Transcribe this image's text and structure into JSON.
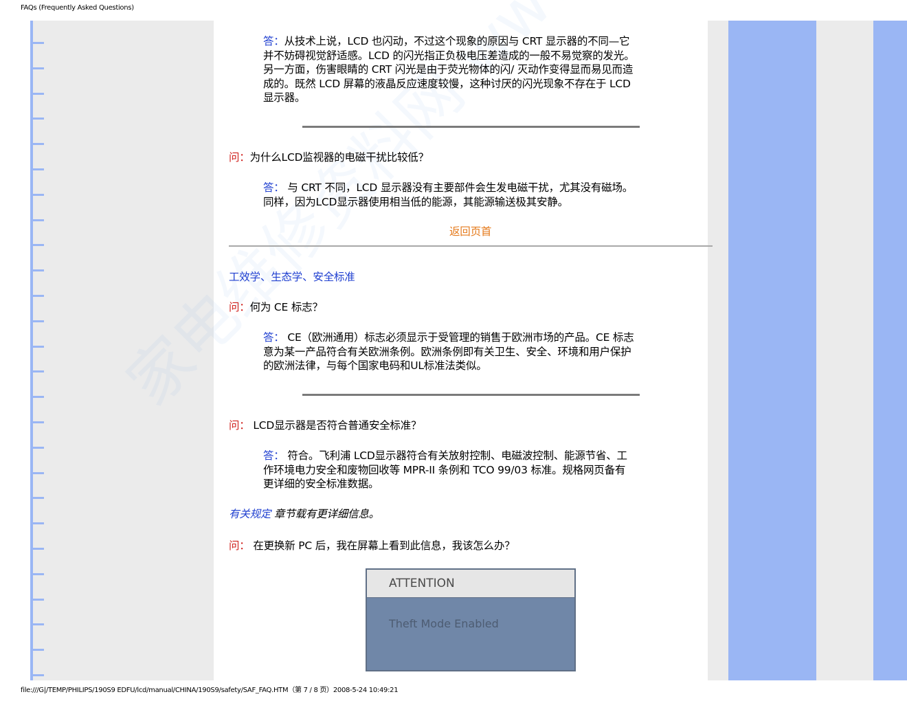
{
  "header": {
    "title": "FAQs (Frequently Asked Questions)"
  },
  "footer": {
    "path": "file:///G|/TEMP/PHILIPS/190S9 EDFU/lcd/manual/CHINA/190S9/safety/SAF_FAQ.HTM（第 7 / 8 页）2008-5-24 10:49:21"
  },
  "labels": {
    "q": "问：",
    "a": "答："
  },
  "qa1": {
    "lines": [
      "从技术上说，LCD 也闪动，不过这个现象的原因与  CRT  显示器的不同—它",
      "并不妨碍视觉舒适感。LCD 的闪光指正负极电压差造成的一般不易觉察的发光。",
      "另一方面，伤害眼睛的  CRT  闪光是由于荧光物体的闪/ 灭动作变得显而易见而造",
      "成的。既然  LCD 屏幕的液晶反应速度较慢，这种讨厌的闪光现象不存在于  LCD",
      "显示器。"
    ]
  },
  "qa2": {
    "question": "为什么LCD监视器的电磁干扰比较低？",
    "lines": [
      " 与  CRT  不同，LCD 显示器没有主要部件会生发电磁干扰，尤其没有磁场。",
      "同样，因为LCD显示器使用相当低的能源，其能源输送极其安静。"
    ]
  },
  "back_to_top": "返回页首",
  "section": {
    "title": "工效学、生态学、安全标准"
  },
  "qa3": {
    "question": "何为  CE  标志？",
    "lines": [
      " CE（欧洲通用）标志必须显示于受管理的销售于欧洲市场的产品。CE  标志",
      "意为某一产品符合有关欧洲条例。欧洲条例即有关卫生、安全、环境和用户保护",
      "的欧洲法律，与每个国家电码和UL标准法类似。"
    ]
  },
  "qa4": {
    "question": " LCD显示器是否符合普通安全标准？",
    "lines": [
      " 符合。飞利浦  LCD显示器符合有关放射控制、电磁波控制、能源节省、工",
      "作环境电力安全和废物回收等  MPR-II  条例和  TCO 99/03  标准。规格网页备有",
      "更详细的安全标准数据。"
    ]
  },
  "regulatory": {
    "link": "有关规定",
    "rest": " 章节载有更详细信息。"
  },
  "qa5": {
    "question": " 在更换新  PC  后，我在屏幕上看到此信息，我该怎么办？"
  },
  "attention_box": {
    "title": "ATTENTION",
    "message": "Theft Mode Enabled"
  },
  "watermark": "家电维修资料网 www.520101.com",
  "colors": {
    "rail_blue": "#9ab6f4",
    "panel_gray": "#ebebeb",
    "label_blue": "#1f3fd0",
    "label_red": "#d0201c",
    "link_orange": "#e57a1b"
  }
}
